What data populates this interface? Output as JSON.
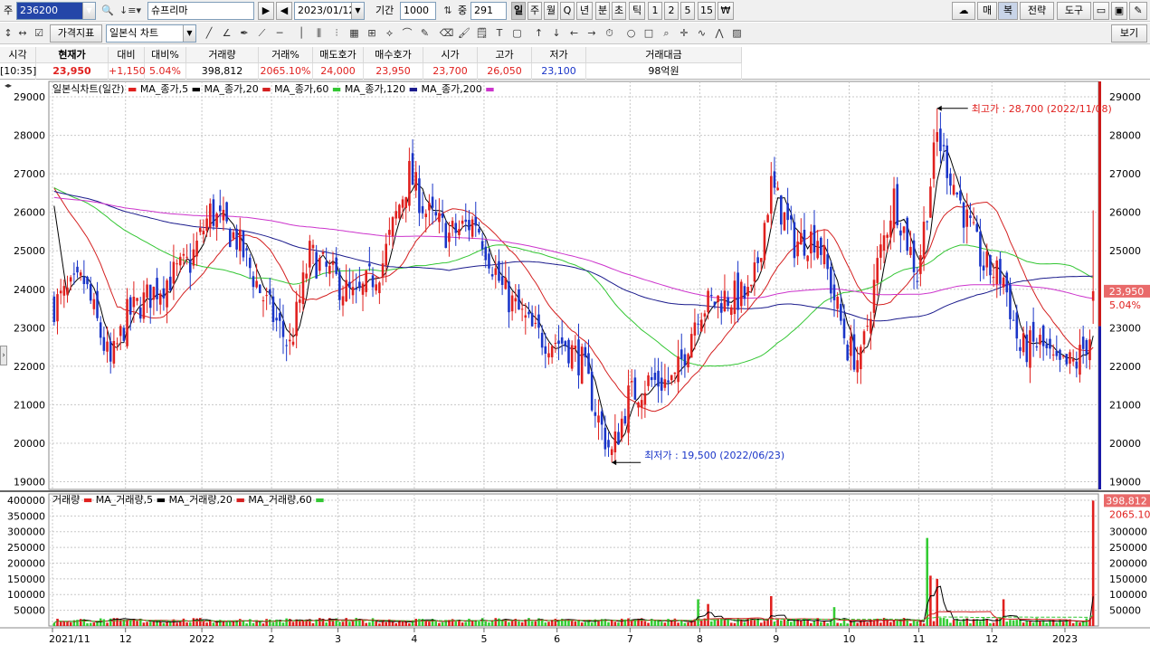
{
  "toolbar1": {
    "stock_label": "주",
    "stock_code": "236200",
    "stock_name": "슈프리마",
    "date": "2023/01/12",
    "period_label": "기간",
    "period_value": "1000",
    "count_label": "중",
    "count_value": "291",
    "period_buttons": [
      "일",
      "주",
      "월",
      "Q",
      "년",
      "분",
      "초",
      "틱",
      "1",
      "2",
      "5",
      "15",
      "₩"
    ],
    "right_buttons": [
      "매",
      "복",
      "전략",
      "도구"
    ]
  },
  "toolbar2": {
    "indicator_button": "가격지표",
    "chart_type": "일본식 차트",
    "view_button": "보기"
  },
  "quote": {
    "headers": [
      "시각",
      "현재가",
      "대비",
      "대비%",
      "거래량",
      "거래%",
      "매도호가",
      "매수호가",
      "시가",
      "고가",
      "저가",
      "거래대금"
    ],
    "values": [
      "[10:35]",
      "23,950",
      "+1,150",
      "5.04%",
      "398,812",
      "2065.10%",
      "24,000",
      "23,950",
      "23,700",
      "26,050",
      "23,100",
      "98억원"
    ]
  },
  "price_legend": {
    "chart": "일본식차트(일간)",
    "ma": [
      "MA_종가,5",
      "MA_종가,20",
      "MA_종가,60",
      "MA_종가,120",
      "MA_종가,200"
    ]
  },
  "volume_legend": {
    "title": "거래량",
    "ma": [
      "MA_거래량,5",
      "MA_거래량,20",
      "MA_거래량,60"
    ]
  },
  "annotations": {
    "high": "최고가 : 28,700 (2022/11/08)",
    "low": "최저가 : 19,500 (2022/06/23)"
  },
  "badges": {
    "price": "23,950",
    "pct": "5.04%",
    "volume": "398,812",
    "volume_pct": "2065.10%"
  },
  "colors": {
    "up": "#e0201e",
    "down": "#1a35c8",
    "ma5": "#000000",
    "ma20": "#d42020",
    "ma60": "#33c633",
    "ma120": "#1a1a8c",
    "ma200": "#cc33cc",
    "vol_up": "#e0201e",
    "vol_down": "#33cc33"
  },
  "chart_data": [
    {
      "type": "candlestick",
      "title": "일본식차트(일간)",
      "ylim": [
        18800,
        29400
      ],
      "y_ticks": [
        19000,
        20000,
        21000,
        22000,
        23000,
        24000,
        25000,
        26000,
        27000,
        28000,
        29000
      ],
      "x_ticks": [
        "2021/11",
        "12",
        "2022",
        "2",
        "3",
        "4",
        "5",
        "6",
        "7",
        "8",
        "9",
        "10",
        "11",
        "12",
        "2023"
      ],
      "keyframes": [
        [
          "2021-11-01",
          23600
        ],
        [
          "2021-11-12",
          24200
        ],
        [
          "2021-11-24",
          22000
        ],
        [
          "2021-12-01",
          23300
        ],
        [
          "2021-12-15",
          24100
        ],
        [
          "2021-12-28",
          24700
        ],
        [
          "2022-01-05",
          26000
        ],
        [
          "2022-01-17",
          25300
        ],
        [
          "2022-01-28",
          23600
        ],
        [
          "2022-02-08",
          22500
        ],
        [
          "2022-02-16",
          24900
        ],
        [
          "2022-02-25",
          24300
        ],
        [
          "2022-03-08",
          23700
        ],
        [
          "2022-03-18",
          24700
        ],
        [
          "2022-03-25",
          26200
        ],
        [
          "2022-03-30",
          27000
        ],
        [
          "2022-04-06",
          26000
        ],
        [
          "2022-04-15",
          25400
        ],
        [
          "2022-04-27",
          25800
        ],
        [
          "2022-05-09",
          24000
        ],
        [
          "2022-05-23",
          22800
        ],
        [
          "2022-06-03",
          22600
        ],
        [
          "2022-06-10",
          22100
        ],
        [
          "2022-06-17",
          20600
        ],
        [
          "2022-06-23",
          19700
        ],
        [
          "2022-06-30",
          21200
        ],
        [
          "2022-07-08",
          21600
        ],
        [
          "2022-07-20",
          21600
        ],
        [
          "2022-07-29",
          23500
        ],
        [
          "2022-08-10",
          23800
        ],
        [
          "2022-08-22",
          23800
        ],
        [
          "2022-08-30",
          26700
        ],
        [
          "2022-09-08",
          25200
        ],
        [
          "2022-09-19",
          25400
        ],
        [
          "2022-09-30",
          22500
        ],
        [
          "2022-10-06",
          22100
        ],
        [
          "2022-10-13",
          24600
        ],
        [
          "2022-10-20",
          26400
        ],
        [
          "2022-10-31",
          24400
        ],
        [
          "2022-11-08",
          28000
        ],
        [
          "2022-11-18",
          26000
        ],
        [
          "2022-11-28",
          24600
        ],
        [
          "2022-12-06",
          24300
        ],
        [
          "2022-12-13",
          22400
        ],
        [
          "2022-12-21",
          22600
        ],
        [
          "2022-12-28",
          21900
        ],
        [
          "2023-01-05",
          22100
        ],
        [
          "2023-01-11",
          22800
        ]
      ],
      "last_candle": {
        "date": "2023-01-12",
        "open": 23700,
        "high": 26050,
        "low": 23100,
        "close": 23950
      },
      "annotations": [
        {
          "label": "최고가",
          "date": "2022-11-08",
          "value": 28700
        },
        {
          "label": "최저가",
          "date": "2022-06-23",
          "value": 19500
        }
      ],
      "series": [
        {
          "name": "MA_종가,5"
        },
        {
          "name": "MA_종가,20"
        },
        {
          "name": "MA_종가,60"
        },
        {
          "name": "MA_종가,120"
        },
        {
          "name": "MA_종가,200"
        }
      ]
    },
    {
      "type": "bar",
      "title": "거래량",
      "ylim": [
        0,
        420000
      ],
      "y_ticks": [
        50000,
        100000,
        150000,
        200000,
        250000,
        300000,
        350000,
        400000
      ],
      "last_volume": 398812,
      "spikes": [
        {
          "date": "2022-07-29",
          "value": 85000
        },
        {
          "date": "2022-08-03",
          "value": 70000
        },
        {
          "date": "2022-08-30",
          "value": 95000
        },
        {
          "date": "2022-09-26",
          "value": 60000
        },
        {
          "date": "2022-11-03",
          "value": 280000
        },
        {
          "date": "2022-11-04",
          "value": 160000
        },
        {
          "date": "2022-11-08",
          "value": 150000
        },
        {
          "date": "2022-12-06",
          "value": 85000
        },
        {
          "date": "2023-01-12",
          "value": 398812
        }
      ],
      "series": [
        {
          "name": "MA_거래량,5"
        },
        {
          "name": "MA_거래량,20"
        },
        {
          "name": "MA_거래량,60"
        }
      ]
    }
  ]
}
